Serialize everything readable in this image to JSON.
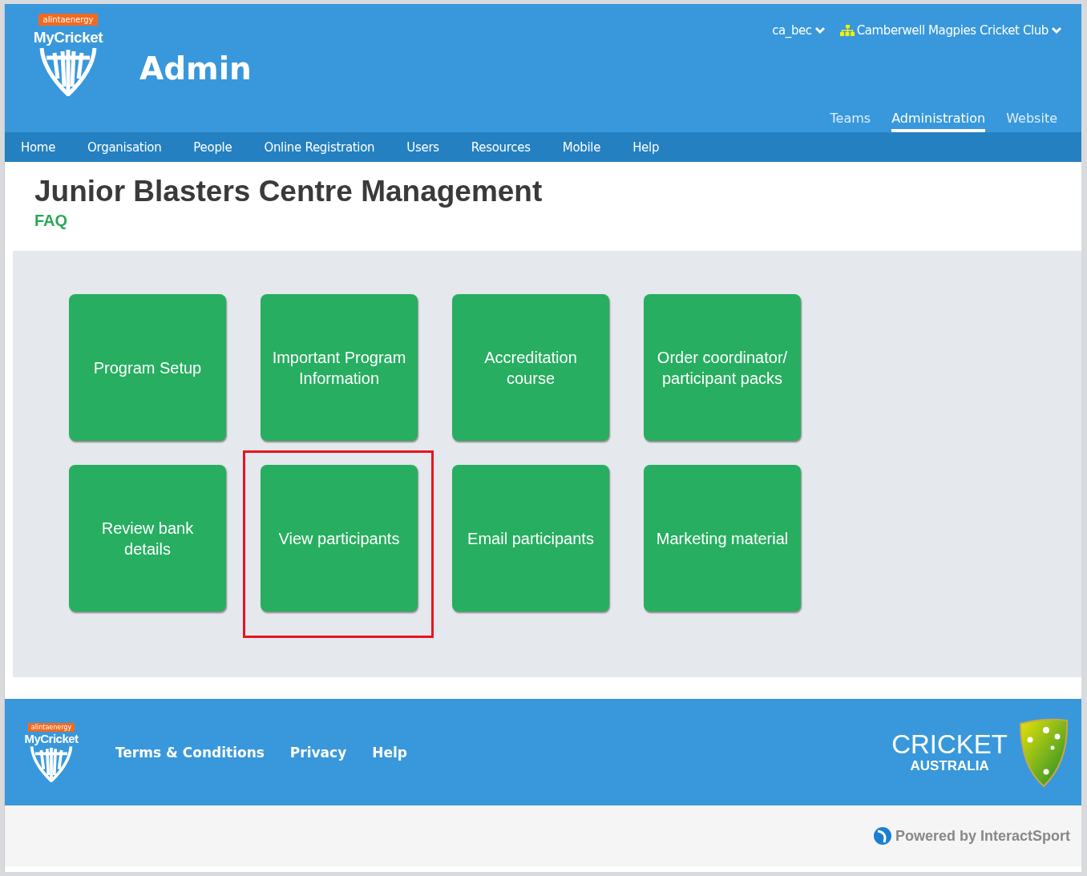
{
  "header": {
    "logo": {
      "sponsor": "alintaenergy",
      "brand": "MyCricket"
    },
    "title": "Admin",
    "user": "ca_bec",
    "organisation": "Camberwell Magpies Cricket Club",
    "sections": [
      {
        "label": "Teams",
        "selected": false
      },
      {
        "label": "Administration",
        "selected": true
      },
      {
        "label": "Website",
        "selected": false
      }
    ]
  },
  "nav": [
    "Home",
    "Organisation",
    "People",
    "Online Registration",
    "Users",
    "Resources",
    "Mobile",
    "Help"
  ],
  "page": {
    "title": "Junior Blasters Centre Management",
    "link": "FAQ"
  },
  "tiles": [
    {
      "label": "Program Setup",
      "highlighted": false
    },
    {
      "label": "Important Program Information",
      "highlighted": false
    },
    {
      "label": "Accreditation course",
      "highlighted": false
    },
    {
      "label": "Order coordinator/ participant packs",
      "highlighted": false
    },
    {
      "label": "Review bank details",
      "highlighted": false
    },
    {
      "label": "View participants",
      "highlighted": true
    },
    {
      "label": "Email participants",
      "highlighted": false
    },
    {
      "label": "Marketing material",
      "highlighted": false
    }
  ],
  "footer": {
    "logo": {
      "sponsor": "alintaenergy",
      "brand": "MyCricket"
    },
    "links": [
      "Terms & Conditions",
      "Privacy",
      "Help"
    ],
    "partner": {
      "name": "CRICKET",
      "sub": "AUSTRALIA"
    },
    "powered_by": "Powered by InteractSport"
  }
}
